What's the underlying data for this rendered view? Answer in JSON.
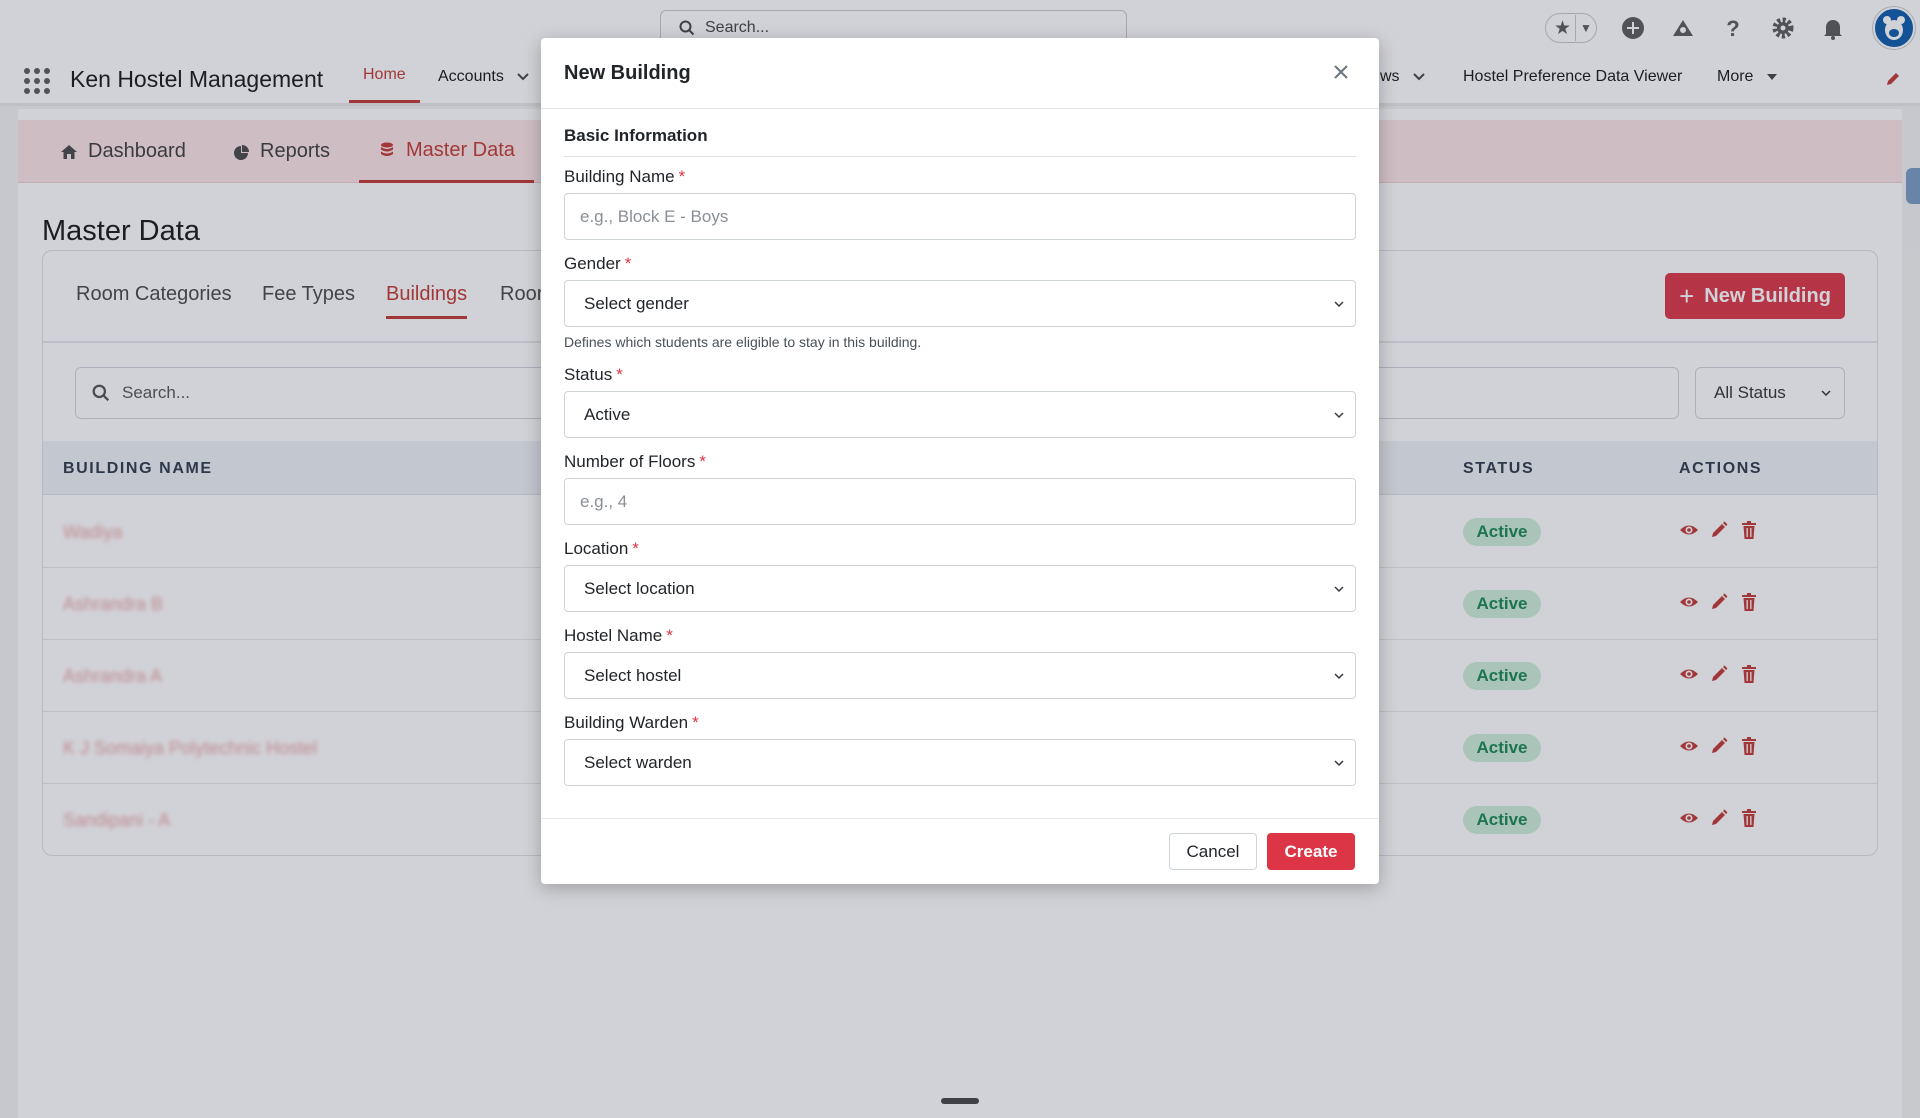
{
  "global_header": {
    "search_placeholder": "Search...",
    "icons": [
      "star-icon",
      "add-icon",
      "setup-assistant-icon",
      "help-icon",
      "gear-icon",
      "bell-icon",
      "avatar"
    ]
  },
  "nav": {
    "app_name": "Ken Hostel Management",
    "items": [
      {
        "label": "Home",
        "active": true
      },
      {
        "label": "Accounts",
        "has_menu": true
      },
      {
        "label": "ws",
        "has_menu": true
      },
      {
        "label": "Hostel Preference Data Viewer"
      },
      {
        "label": "More",
        "has_menu": true
      }
    ]
  },
  "app_tabs": [
    {
      "label": "Dashboard",
      "icon": "home-icon"
    },
    {
      "label": "Reports",
      "icon": "pie-chart-icon"
    },
    {
      "label": "Master Data",
      "icon": "database-icon",
      "active": true
    }
  ],
  "page": {
    "title": "Master Data",
    "sub_tabs": [
      {
        "label": "Room Categories"
      },
      {
        "label": "Fee Types"
      },
      {
        "label": "Buildings",
        "active": true
      },
      {
        "label": "Roor"
      }
    ],
    "new_button_label": "New Building",
    "search_placeholder": "Search...",
    "status_filter": "All Status",
    "columns": [
      "BUILDING NAME",
      "STATUS",
      "ACTIONS"
    ],
    "rows": [
      {
        "name": "Wadiya",
        "status": "Active"
      },
      {
        "name": "Ashrandra B",
        "status": "Active"
      },
      {
        "name": "Ashrandra A",
        "status": "Active"
      },
      {
        "name": "K J Somaiya Polytechnic Hostel",
        "status": "Active"
      },
      {
        "name": "Sandipani - A",
        "status": "Active"
      }
    ]
  },
  "modal": {
    "title": "New Building",
    "section_title": "Basic Information",
    "fields": {
      "building_name": {
        "label": "Building Name",
        "placeholder": "e.g., Block E - Boys"
      },
      "gender": {
        "label": "Gender",
        "value": "Select gender",
        "helper": "Defines which students are eligible to stay in this building."
      },
      "status": {
        "label": "Status",
        "value": "Active"
      },
      "floors": {
        "label": "Number of Floors",
        "placeholder": "e.g., 4"
      },
      "location": {
        "label": "Location",
        "value": "Select location"
      },
      "hostel_name": {
        "label": "Hostel Name",
        "value": "Select hostel"
      },
      "warden": {
        "label": "Building Warden",
        "value": "Select warden"
      }
    },
    "required_marker": "*",
    "cancel_label": "Cancel",
    "create_label": "Create"
  },
  "colors": {
    "accent": "#dc3545",
    "active_badge_bg": "#cfeeda",
    "active_badge_text": "#198754",
    "app_tab_bg": "#fce6e6"
  }
}
